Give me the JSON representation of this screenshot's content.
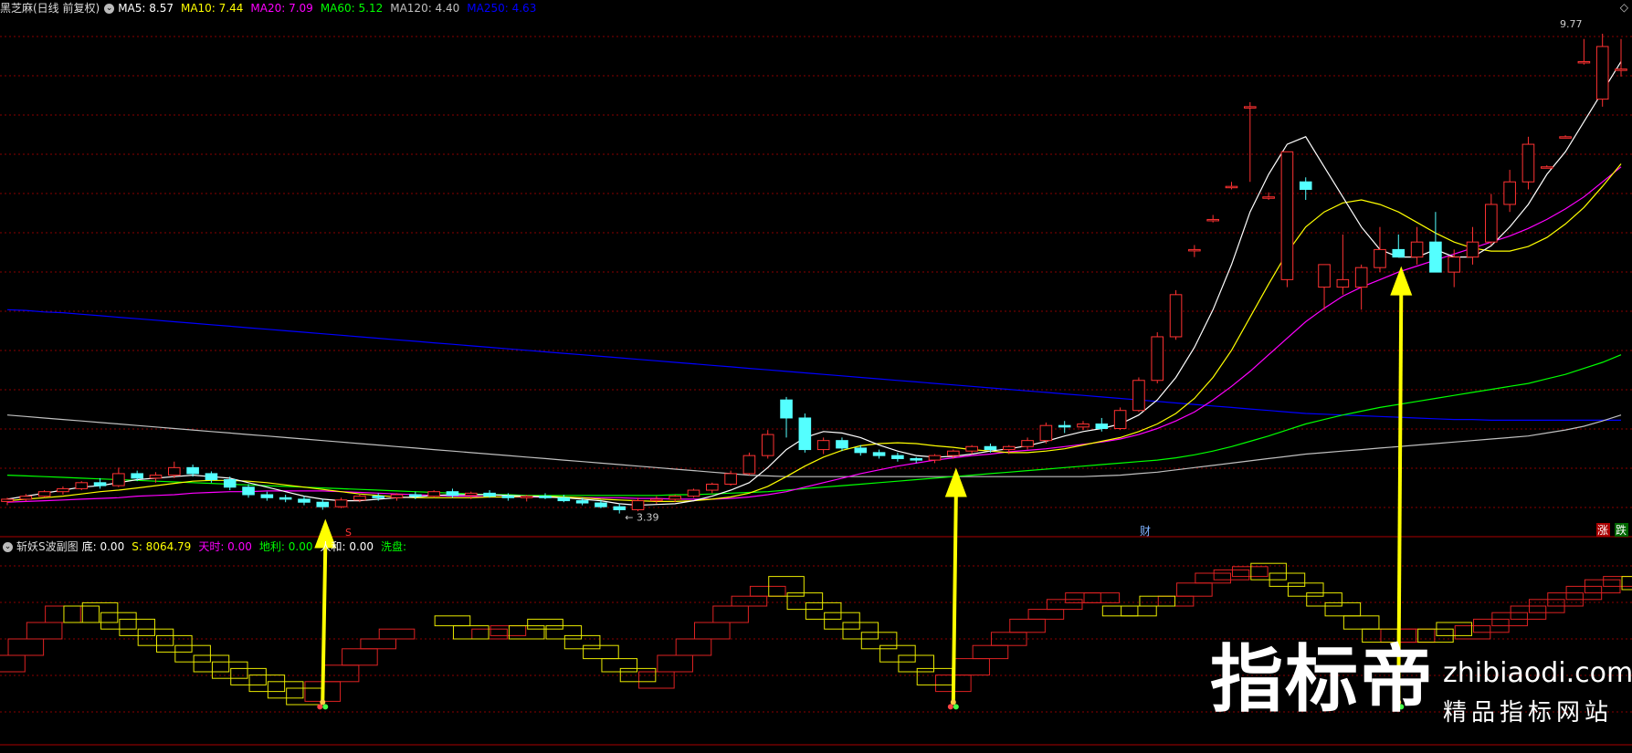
{
  "main_legend": {
    "stock": "黑芝麻(日线 前复权)",
    "items": [
      {
        "label": "MA5: 8.57",
        "color": "#ffffff"
      },
      {
        "label": "MA10: 7.44",
        "color": "#ffff00"
      },
      {
        "label": "MA20: 7.09",
        "color": "#ff00ff"
      },
      {
        "label": "MA60: 5.12",
        "color": "#00ff00"
      },
      {
        "label": "MA120: 4.40",
        "color": "#c0c0c0"
      },
      {
        "label": "MA250: 4.63",
        "color": "#0000ff"
      }
    ]
  },
  "sub_legend": {
    "name": "斩妖S波副图",
    "items": [
      {
        "label": "底: 0.00",
        "color": "#ffffff"
      },
      {
        "label": "S: 8064.79",
        "color": "#ffff00"
      },
      {
        "label": "天时: 0.00",
        "color": "#ff00ff"
      },
      {
        "label": "地利: 0.00",
        "color": "#00ff00"
      },
      {
        "label": "人和: 0.00",
        "color": "#ffffff"
      },
      {
        "label": "洗盘:",
        "color": "#00ff00"
      }
    ]
  },
  "corner_icons": {
    "left": "◇",
    "right": "🔴"
  },
  "watermark": {
    "big": "指标帝",
    "url": "zhibiaodi.com",
    "sub": "精品指标网站"
  },
  "markers": {
    "s_label": "S",
    "cai_label": "财",
    "zhang_label": "涨",
    "die_label": "跌"
  },
  "chart_data": {
    "type": "candlestick",
    "price_high_label": "9.77",
    "price_low_label": "3.39",
    "colors": {
      "up": "#ff3232",
      "down": "#54ffff",
      "ma5": "#ffffff",
      "ma10": "#ffff00",
      "ma20": "#ff00ff",
      "ma60": "#00ff00",
      "ma120": "#c0c0c0",
      "ma250": "#0000ff",
      "arrow": "#ffff00"
    },
    "ylim": [
      3.3,
      10.0
    ],
    "candles": [
      [
        3.55,
        3.6,
        3.5,
        3.58
      ],
      [
        3.58,
        3.65,
        3.55,
        3.62
      ],
      [
        3.62,
        3.7,
        3.6,
        3.68
      ],
      [
        3.68,
        3.75,
        3.64,
        3.72
      ],
      [
        3.72,
        3.82,
        3.7,
        3.8
      ],
      [
        3.8,
        3.86,
        3.72,
        3.76
      ],
      [
        3.76,
        4.0,
        3.74,
        3.92
      ],
      [
        3.92,
        3.96,
        3.82,
        3.86
      ],
      [
        3.86,
        3.94,
        3.8,
        3.9
      ],
      [
        3.9,
        4.08,
        3.86,
        4.0
      ],
      [
        4.0,
        4.04,
        3.88,
        3.92
      ],
      [
        3.92,
        3.95,
        3.8,
        3.84
      ],
      [
        3.84,
        3.88,
        3.7,
        3.74
      ],
      [
        3.74,
        3.78,
        3.6,
        3.64
      ],
      [
        3.64,
        3.68,
        3.56,
        3.6
      ],
      [
        3.6,
        3.64,
        3.54,
        3.58
      ],
      [
        3.58,
        3.62,
        3.5,
        3.54
      ],
      [
        3.54,
        3.58,
        3.44,
        3.48
      ],
      [
        3.48,
        3.6,
        3.46,
        3.57
      ],
      [
        3.57,
        3.64,
        3.54,
        3.62
      ],
      [
        3.62,
        3.66,
        3.56,
        3.6
      ],
      [
        3.6,
        3.66,
        3.56,
        3.64
      ],
      [
        3.64,
        3.68,
        3.58,
        3.62
      ],
      [
        3.62,
        3.7,
        3.6,
        3.68
      ],
      [
        3.68,
        3.72,
        3.6,
        3.63
      ],
      [
        3.63,
        3.68,
        3.58,
        3.66
      ],
      [
        3.66,
        3.7,
        3.6,
        3.62
      ],
      [
        3.62,
        3.66,
        3.56,
        3.6
      ],
      [
        3.6,
        3.64,
        3.55,
        3.62
      ],
      [
        3.62,
        3.66,
        3.58,
        3.6
      ],
      [
        3.6,
        3.64,
        3.54,
        3.56
      ],
      [
        3.56,
        3.6,
        3.5,
        3.53
      ],
      [
        3.53,
        3.57,
        3.46,
        3.48
      ],
      [
        3.48,
        3.52,
        3.39,
        3.44
      ],
      [
        3.44,
        3.6,
        3.42,
        3.56
      ],
      [
        3.56,
        3.62,
        3.52,
        3.58
      ],
      [
        3.58,
        3.64,
        3.54,
        3.62
      ],
      [
        3.62,
        3.72,
        3.6,
        3.7
      ],
      [
        3.7,
        3.8,
        3.66,
        3.78
      ],
      [
        3.78,
        3.96,
        3.76,
        3.92
      ],
      [
        3.92,
        4.2,
        3.9,
        4.16
      ],
      [
        4.16,
        4.5,
        4.12,
        4.44
      ],
      [
        4.9,
        4.94,
        4.4,
        4.66
      ],
      [
        4.66,
        4.72,
        4.2,
        4.24
      ],
      [
        4.24,
        4.4,
        4.18,
        4.36
      ],
      [
        4.36,
        4.4,
        4.22,
        4.26
      ],
      [
        4.26,
        4.3,
        4.16,
        4.2
      ],
      [
        4.2,
        4.24,
        4.12,
        4.16
      ],
      [
        4.16,
        4.2,
        4.08,
        4.12
      ],
      [
        4.12,
        4.14,
        4.06,
        4.1
      ],
      [
        4.1,
        4.18,
        4.06,
        4.16
      ],
      [
        4.16,
        4.24,
        4.12,
        4.22
      ],
      [
        4.22,
        4.3,
        4.18,
        4.28
      ],
      [
        4.28,
        4.32,
        4.2,
        4.24
      ],
      [
        4.24,
        4.3,
        4.18,
        4.28
      ],
      [
        4.28,
        4.4,
        4.24,
        4.36
      ],
      [
        4.36,
        4.6,
        4.32,
        4.56
      ],
      [
        4.56,
        4.62,
        4.46,
        4.54
      ],
      [
        4.54,
        4.62,
        4.5,
        4.58
      ],
      [
        4.58,
        4.66,
        4.48,
        4.52
      ],
      [
        4.52,
        4.8,
        4.5,
        4.76
      ],
      [
        4.76,
        5.2,
        4.74,
        5.16
      ],
      [
        5.16,
        5.8,
        5.12,
        5.74
      ],
      [
        5.74,
        6.36,
        5.7,
        6.3
      ],
      [
        6.9,
        6.96,
        6.8,
        6.9
      ],
      [
        7.3,
        7.36,
        7.26,
        7.3
      ],
      [
        7.74,
        7.8,
        7.7,
        7.74
      ],
      [
        8.8,
        8.86,
        7.8,
        8.8
      ],
      [
        7.6,
        7.66,
        7.56,
        7.6
      ],
      [
        6.5,
        8.2,
        6.4,
        8.2
      ],
      [
        7.8,
        7.86,
        7.56,
        7.7
      ],
      [
        6.4,
        6.7,
        6.1,
        6.7
      ],
      [
        6.4,
        7.1,
        6.3,
        6.5
      ],
      [
        6.4,
        6.7,
        6.1,
        6.66
      ],
      [
        6.66,
        7.2,
        6.6,
        6.9
      ],
      [
        6.9,
        7.1,
        6.8,
        6.8
      ],
      [
        6.8,
        7.2,
        6.7,
        7.0
      ],
      [
        7.0,
        7.4,
        6.6,
        6.6
      ],
      [
        6.6,
        6.9,
        6.4,
        6.8
      ],
      [
        6.8,
        7.2,
        6.7,
        7.0
      ],
      [
        7.0,
        7.64,
        6.96,
        7.5
      ],
      [
        7.5,
        7.96,
        7.4,
        7.8
      ],
      [
        7.8,
        8.4,
        7.7,
        8.3
      ],
      [
        8.0,
        8.02,
        8.0,
        8.0
      ],
      [
        8.4,
        8.42,
        8.4,
        8.4
      ],
      [
        9.4,
        9.7,
        9.36,
        9.4
      ],
      [
        8.9,
        9.77,
        8.8,
        9.6
      ],
      [
        9.3,
        9.7,
        9.2,
        9.3
      ]
    ],
    "ma5": [
      3.58,
      3.62,
      3.66,
      3.7,
      3.74,
      3.76,
      3.8,
      3.84,
      3.86,
      3.88,
      3.9,
      3.88,
      3.86,
      3.8,
      3.74,
      3.68,
      3.62,
      3.58,
      3.56,
      3.56,
      3.58,
      3.6,
      3.61,
      3.63,
      3.64,
      3.64,
      3.64,
      3.63,
      3.62,
      3.61,
      3.6,
      3.58,
      3.56,
      3.52,
      3.5,
      3.51,
      3.52,
      3.56,
      3.62,
      3.7,
      3.8,
      4.0,
      4.24,
      4.4,
      4.48,
      4.46,
      4.4,
      4.3,
      4.22,
      4.16,
      4.14,
      4.15,
      4.18,
      4.22,
      4.25,
      4.29,
      4.35,
      4.42,
      4.48,
      4.52,
      4.58,
      4.7,
      4.9,
      5.2,
      5.6,
      6.1,
      6.7,
      7.4,
      7.9,
      8.3,
      8.4,
      8.0,
      7.6,
      7.2,
      6.9,
      6.8,
      6.8,
      6.9,
      6.8,
      6.8,
      6.95,
      7.2,
      7.5,
      7.9,
      8.2,
      8.6,
      9.0,
      9.4
    ],
    "ma10": [
      3.56,
      3.58,
      3.6,
      3.62,
      3.65,
      3.68,
      3.7,
      3.73,
      3.76,
      3.79,
      3.82,
      3.83,
      3.83,
      3.82,
      3.8,
      3.77,
      3.74,
      3.71,
      3.68,
      3.65,
      3.63,
      3.61,
      3.6,
      3.6,
      3.6,
      3.6,
      3.61,
      3.61,
      3.62,
      3.62,
      3.61,
      3.6,
      3.58,
      3.57,
      3.56,
      3.55,
      3.55,
      3.56,
      3.58,
      3.61,
      3.66,
      3.75,
      3.88,
      4.02,
      4.14,
      4.23,
      4.29,
      4.32,
      4.33,
      4.32,
      4.29,
      4.27,
      4.24,
      4.22,
      4.2,
      4.2,
      4.22,
      4.25,
      4.3,
      4.35,
      4.4,
      4.48,
      4.58,
      4.72,
      4.92,
      5.2,
      5.56,
      6.0,
      6.44,
      6.86,
      7.2,
      7.4,
      7.52,
      7.56,
      7.5,
      7.4,
      7.26,
      7.12,
      7.0,
      6.92,
      6.88,
      6.88,
      6.94,
      7.06,
      7.24,
      7.46,
      7.74,
      8.04
    ],
    "ma20": [
      3.54,
      3.55,
      3.56,
      3.57,
      3.58,
      3.59,
      3.6,
      3.62,
      3.63,
      3.64,
      3.66,
      3.67,
      3.68,
      3.68,
      3.69,
      3.69,
      3.69,
      3.69,
      3.68,
      3.67,
      3.66,
      3.65,
      3.64,
      3.63,
      3.62,
      3.62,
      3.61,
      3.61,
      3.61,
      3.61,
      3.6,
      3.6,
      3.6,
      3.6,
      3.59,
      3.59,
      3.58,
      3.58,
      3.58,
      3.59,
      3.61,
      3.64,
      3.68,
      3.74,
      3.8,
      3.86,
      3.92,
      3.97,
      4.02,
      4.06,
      4.1,
      4.13,
      4.16,
      4.18,
      4.21,
      4.23,
      4.25,
      4.28,
      4.31,
      4.34,
      4.38,
      4.44,
      4.52,
      4.62,
      4.74,
      4.9,
      5.08,
      5.28,
      5.5,
      5.72,
      5.94,
      6.12,
      6.28,
      6.4,
      6.5,
      6.6,
      6.68,
      6.76,
      6.84,
      6.92,
      7.0,
      7.08,
      7.18,
      7.3,
      7.44,
      7.6,
      7.8,
      8.0
    ],
    "ma60": [
      3.9,
      3.89,
      3.88,
      3.87,
      3.86,
      3.85,
      3.84,
      3.83,
      3.82,
      3.81,
      3.8,
      3.79,
      3.78,
      3.77,
      3.76,
      3.75,
      3.74,
      3.73,
      3.72,
      3.71,
      3.7,
      3.69,
      3.68,
      3.67,
      3.66,
      3.65,
      3.64,
      3.64,
      3.63,
      3.63,
      3.63,
      3.63,
      3.63,
      3.63,
      3.63,
      3.63,
      3.64,
      3.64,
      3.65,
      3.66,
      3.67,
      3.68,
      3.7,
      3.72,
      3.74,
      3.76,
      3.78,
      3.8,
      3.82,
      3.84,
      3.86,
      3.88,
      3.9,
      3.92,
      3.94,
      3.96,
      3.98,
      4.0,
      4.02,
      4.04,
      4.06,
      4.08,
      4.1,
      4.13,
      4.17,
      4.22,
      4.28,
      4.35,
      4.42,
      4.5,
      4.58,
      4.64,
      4.7,
      4.75,
      4.8,
      4.84,
      4.88,
      4.92,
      4.96,
      5.0,
      5.04,
      5.08,
      5.12,
      5.18,
      5.24,
      5.32,
      5.4,
      5.5
    ],
    "ma120": [
      4.7,
      4.68,
      4.66,
      4.64,
      4.62,
      4.6,
      4.58,
      4.56,
      4.54,
      4.52,
      4.5,
      4.48,
      4.46,
      4.44,
      4.42,
      4.4,
      4.38,
      4.36,
      4.34,
      4.32,
      4.3,
      4.28,
      4.26,
      4.24,
      4.22,
      4.2,
      4.18,
      4.16,
      4.14,
      4.12,
      4.1,
      4.08,
      4.06,
      4.04,
      4.02,
      4.0,
      3.98,
      3.96,
      3.94,
      3.92,
      3.9,
      3.89,
      3.88,
      3.88,
      3.88,
      3.88,
      3.88,
      3.88,
      3.88,
      3.88,
      3.88,
      3.88,
      3.88,
      3.88,
      3.88,
      3.88,
      3.88,
      3.88,
      3.88,
      3.89,
      3.9,
      3.92,
      3.94,
      3.97,
      4.0,
      4.03,
      4.06,
      4.09,
      4.12,
      4.15,
      4.18,
      4.2,
      4.22,
      4.24,
      4.26,
      4.28,
      4.3,
      4.32,
      4.34,
      4.36,
      4.38,
      4.4,
      4.42,
      4.46,
      4.5,
      4.55,
      4.62,
      4.7
    ],
    "ma250": [
      6.1,
      6.09,
      6.07,
      6.06,
      6.04,
      6.02,
      6.0,
      5.98,
      5.96,
      5.94,
      5.92,
      5.9,
      5.88,
      5.86,
      5.84,
      5.82,
      5.8,
      5.78,
      5.76,
      5.74,
      5.72,
      5.7,
      5.68,
      5.66,
      5.64,
      5.62,
      5.6,
      5.58,
      5.56,
      5.54,
      5.52,
      5.5,
      5.48,
      5.46,
      5.44,
      5.42,
      5.4,
      5.38,
      5.36,
      5.34,
      5.32,
      5.3,
      5.28,
      5.26,
      5.24,
      5.22,
      5.2,
      5.18,
      5.16,
      5.14,
      5.12,
      5.1,
      5.08,
      5.06,
      5.04,
      5.02,
      5.0,
      4.98,
      4.96,
      4.94,
      4.92,
      4.9,
      4.88,
      4.86,
      4.84,
      4.82,
      4.8,
      4.78,
      4.76,
      4.74,
      4.72,
      4.71,
      4.7,
      4.69,
      4.68,
      4.67,
      4.66,
      4.65,
      4.64,
      4.64,
      4.63,
      4.63,
      4.63,
      4.63,
      4.63,
      4.63,
      4.63,
      4.63
    ],
    "wave": {
      "ylim": [
        0,
        10
      ],
      "red_segments": [
        [
          0,
          3.0,
          4.0
        ],
        [
          1,
          4.0,
          5.0
        ],
        [
          2,
          5.0,
          6.0
        ],
        [
          3,
          6.0,
          7.0
        ],
        [
          17,
          1.2,
          2.4
        ],
        [
          18,
          2.4,
          3.4
        ],
        [
          19,
          3.4,
          4.4
        ],
        [
          20,
          4.4,
          5.0
        ],
        [
          21,
          5.0,
          5.6
        ],
        [
          26,
          5.0,
          5.6
        ],
        [
          27,
          5.2,
          5.8
        ],
        [
          35,
          2.0,
          3.0
        ],
        [
          36,
          3.0,
          4.0
        ],
        [
          37,
          4.0,
          5.0
        ],
        [
          38,
          5.0,
          6.0
        ],
        [
          39,
          6.0,
          7.0
        ],
        [
          40,
          7.0,
          7.6
        ],
        [
          41,
          7.6,
          8.2
        ],
        [
          51,
          1.8,
          2.8
        ],
        [
          52,
          2.8,
          3.8
        ],
        [
          53,
          3.8,
          4.6
        ],
        [
          54,
          4.6,
          5.4
        ],
        [
          55,
          5.4,
          6.2
        ],
        [
          56,
          6.2,
          6.8
        ],
        [
          57,
          6.8,
          7.4
        ],
        [
          58,
          7.2,
          7.8
        ],
        [
          59,
          7.2,
          7.8
        ],
        [
          63,
          7.0,
          7.6
        ],
        [
          64,
          7.6,
          8.4
        ],
        [
          65,
          8.4,
          9.0
        ],
        [
          66,
          8.6,
          9.2
        ],
        [
          67,
          8.8,
          9.4
        ],
        [
          75,
          4.8,
          5.6
        ],
        [
          76,
          4.8,
          5.6
        ],
        [
          79,
          5.0,
          5.8
        ],
        [
          80,
          5.4,
          6.2
        ],
        [
          81,
          5.8,
          6.6
        ],
        [
          82,
          6.2,
          7.0
        ],
        [
          83,
          6.6,
          7.4
        ],
        [
          84,
          7.0,
          7.8
        ],
        [
          85,
          7.4,
          8.2
        ],
        [
          86,
          7.8,
          8.6
        ],
        [
          87,
          8.2,
          8.8
        ]
      ],
      "yellow_segments": [
        [
          4,
          6.0,
          7.0
        ],
        [
          5,
          6.0,
          7.2
        ],
        [
          6,
          5.6,
          6.6
        ],
        [
          7,
          5.2,
          6.2
        ],
        [
          8,
          4.6,
          5.6
        ],
        [
          9,
          4.2,
          5.2
        ],
        [
          10,
          3.6,
          4.6
        ],
        [
          11,
          3.0,
          4.0
        ],
        [
          12,
          2.6,
          3.6
        ],
        [
          13,
          2.2,
          3.2
        ],
        [
          14,
          1.8,
          2.8
        ],
        [
          15,
          1.4,
          2.4
        ],
        [
          16,
          1.0,
          2.0
        ],
        [
          24,
          5.8,
          6.4
        ],
        [
          25,
          5.0,
          5.8
        ],
        [
          28,
          5.0,
          5.8
        ],
        [
          29,
          5.6,
          6.2
        ],
        [
          30,
          5.0,
          5.8
        ],
        [
          31,
          4.4,
          5.2
        ],
        [
          32,
          3.8,
          4.6
        ],
        [
          33,
          3.0,
          3.8
        ],
        [
          34,
          2.4,
          3.2
        ],
        [
          42,
          7.6,
          8.8
        ],
        [
          43,
          6.8,
          7.8
        ],
        [
          44,
          6.2,
          7.2
        ],
        [
          45,
          5.6,
          6.6
        ],
        [
          46,
          5.0,
          6.0
        ],
        [
          47,
          4.4,
          5.4
        ],
        [
          48,
          3.6,
          4.6
        ],
        [
          49,
          3.0,
          4.0
        ],
        [
          50,
          2.2,
          3.2
        ],
        [
          60,
          6.4,
          7.0
        ],
        [
          61,
          6.4,
          7.0
        ],
        [
          62,
          7.0,
          7.6
        ],
        [
          68,
          8.6,
          9.6
        ],
        [
          69,
          8.2,
          9.0
        ],
        [
          70,
          7.6,
          8.4
        ],
        [
          71,
          7.0,
          7.8
        ],
        [
          72,
          6.4,
          7.2
        ],
        [
          73,
          5.6,
          6.4
        ],
        [
          74,
          4.8,
          5.6
        ],
        [
          77,
          4.8,
          5.6
        ],
        [
          78,
          5.2,
          6.0
        ],
        [
          88,
          8.0,
          8.8
        ]
      ]
    },
    "arrows": [
      17,
      51,
      75
    ]
  }
}
